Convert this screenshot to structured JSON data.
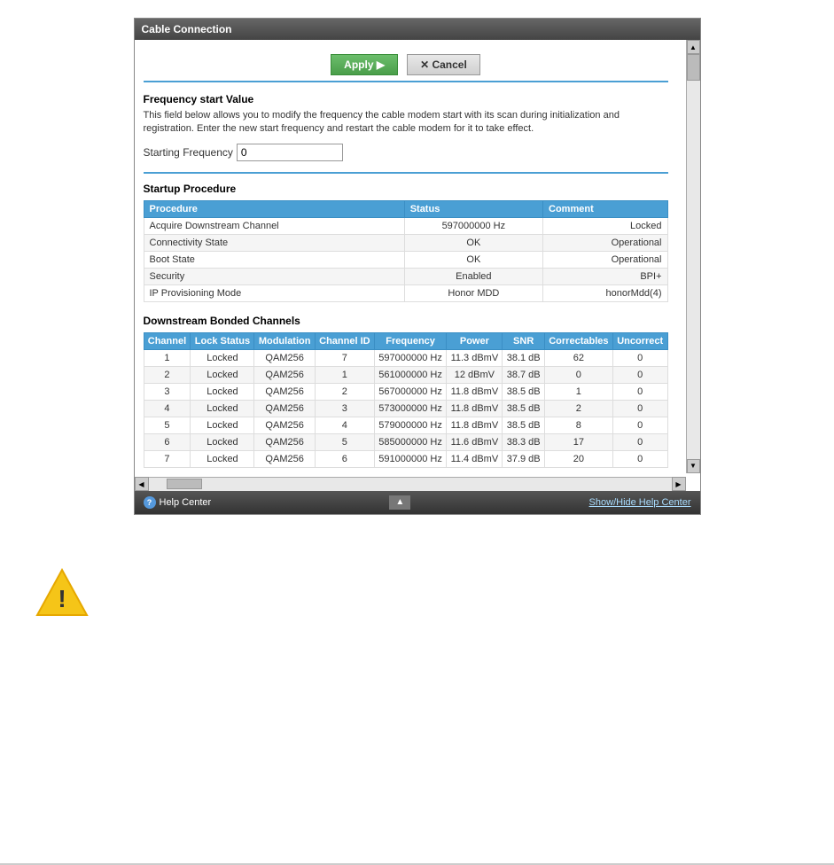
{
  "panel": {
    "title": "Cable Connection",
    "toolbar": {
      "apply_label": "Apply ▶",
      "cancel_label": "✕ Cancel"
    },
    "frequency_section": {
      "title": "Frequency start Value",
      "description": "This field below allows you to modify the frequency the cable modem start with its scan during initialization and registration. Enter the new start frequency and restart the cable modem for it to take effect.",
      "label": "Starting Frequency",
      "value": "0"
    },
    "startup_section": {
      "title": "Startup Procedure",
      "columns": [
        "Procedure",
        "Status",
        "Comment"
      ],
      "rows": [
        [
          "Acquire Downstream Channel",
          "597000000 Hz",
          "Locked"
        ],
        [
          "Connectivity State",
          "OK",
          "Operational"
        ],
        [
          "Boot State",
          "OK",
          "Operational"
        ],
        [
          "Security",
          "Enabled",
          "BPI+"
        ],
        [
          "IP Provisioning Mode",
          "Honor MDD",
          "honorMdd(4)"
        ]
      ]
    },
    "downstream_section": {
      "title": "Downstream Bonded Channels",
      "columns": [
        "Channel",
        "Lock Status",
        "Modulation",
        "Channel ID",
        "Frequency",
        "Power",
        "SNR",
        "Correctables",
        "Uncorrect"
      ],
      "rows": [
        [
          "1",
          "Locked",
          "QAM256",
          "7",
          "597000000 Hz",
          "11.3 dBmV",
          "38.1 dB",
          "62",
          "0"
        ],
        [
          "2",
          "Locked",
          "QAM256",
          "1",
          "561000000 Hz",
          "12 dBmV",
          "38.7 dB",
          "0",
          "0"
        ],
        [
          "3",
          "Locked",
          "QAM256",
          "2",
          "567000000 Hz",
          "11.8 dBmV",
          "38.5 dB",
          "1",
          "0"
        ],
        [
          "4",
          "Locked",
          "QAM256",
          "3",
          "573000000 Hz",
          "11.8 dBmV",
          "38.5 dB",
          "2",
          "0"
        ],
        [
          "5",
          "Locked",
          "QAM256",
          "4",
          "579000000 Hz",
          "11.8 dBmV",
          "38.5 dB",
          "8",
          "0"
        ],
        [
          "6",
          "Locked",
          "QAM256",
          "5",
          "585000000 Hz",
          "11.6 dBmV",
          "38.3 dB",
          "17",
          "0"
        ],
        [
          "7",
          "Locked",
          "QAM256",
          "6",
          "591000000 Hz",
          "11.4 dBmV",
          "37.9 dB",
          "20",
          "0"
        ]
      ]
    },
    "footer": {
      "help_label": "Help Center",
      "show_hide_label": "Show/Hide Help Center"
    }
  },
  "warning": {
    "visible": true
  }
}
